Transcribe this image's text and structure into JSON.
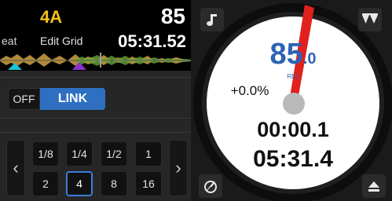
{
  "deck": {
    "key": "4A",
    "bpm": "85",
    "beat_label": "eat",
    "edit_grid_label": "Edit Grid",
    "time_remaining": "05:31.52"
  },
  "sync": {
    "off_label": "OFF",
    "link_label": "LINK"
  },
  "loop_pads": {
    "prev_icon": "chevron-left-icon",
    "next_icon": "chevron-right-icon",
    "row1": [
      "1/8",
      "1/4",
      "1/2",
      "1"
    ],
    "row2": [
      "2",
      "4",
      "8",
      "16"
    ],
    "selected": "4"
  },
  "platter": {
    "bpm_major": "85",
    "bpm_minor": ".0",
    "bpm_unit": "REL",
    "pitch": "+0.0%",
    "elapsed": "00:00.1",
    "total": "05:31.4",
    "needle_color": "#e0211d",
    "bpm_color": "#2e63b4"
  },
  "buttons": {
    "note_icon": "music-note-icon",
    "menu_icon": "menu-triangle-icon",
    "tempo_icon": "tempo-dial-icon",
    "eject_icon": "eject-icon"
  },
  "colors": {
    "link_blue": "#2f6fc1",
    "key_yellow": "#f2c318",
    "cue_cyan": "#19c2d6",
    "cue_purple": "#8a33c9"
  }
}
